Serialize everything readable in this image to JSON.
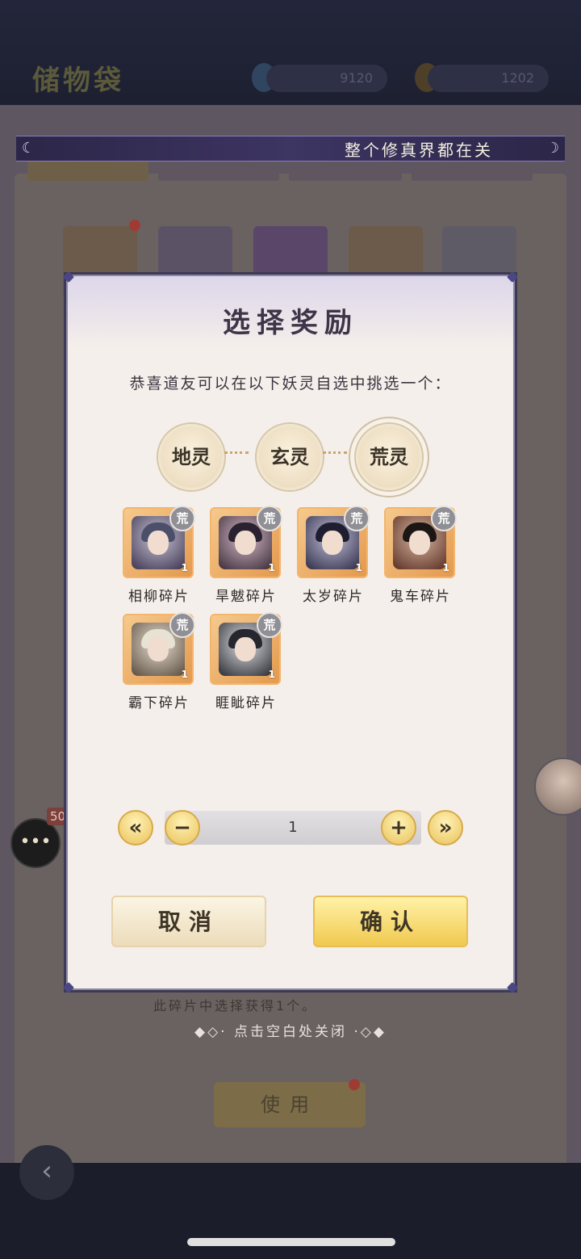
{
  "background": {
    "title": "储物袋",
    "currency_1": "9120",
    "currency_2": "1202",
    "marquee_text": "整个修真界都在关",
    "under_text": "此碎片中选择获得1个。",
    "use_button": "使用",
    "chat_badge": "50",
    "hint": "点击空白处关闭"
  },
  "dialog": {
    "title": "选择奖励",
    "subtitle": "恭喜道友可以在以下妖灵自选中挑选一个：",
    "tiers": [
      {
        "label": "地灵",
        "active": false
      },
      {
        "label": "玄灵",
        "active": false
      },
      {
        "label": "荒灵",
        "active": true
      }
    ],
    "items": [
      {
        "label": "相柳碎片",
        "badge": "荒",
        "count": "1"
      },
      {
        "label": "旱魃碎片",
        "badge": "荒",
        "count": "1"
      },
      {
        "label": "太岁碎片",
        "badge": "荒",
        "count": "1"
      },
      {
        "label": "鬼车碎片",
        "badge": "荒",
        "count": "1"
      },
      {
        "label": "霸下碎片",
        "badge": "荒",
        "count": "1"
      },
      {
        "label": "睚眦碎片",
        "badge": "荒",
        "count": "1"
      }
    ],
    "quantity": "1",
    "stepper": {
      "first": "«",
      "minus": "−",
      "plus": "+",
      "last": "»"
    },
    "cancel_label": "取消",
    "confirm_label": "确认"
  },
  "colors": {
    "accent_gold": "#f0c94f",
    "frame_orange": "#e49a4e",
    "dialog_bg": "#f5efeb",
    "dialog_border": "#8d86a8"
  }
}
